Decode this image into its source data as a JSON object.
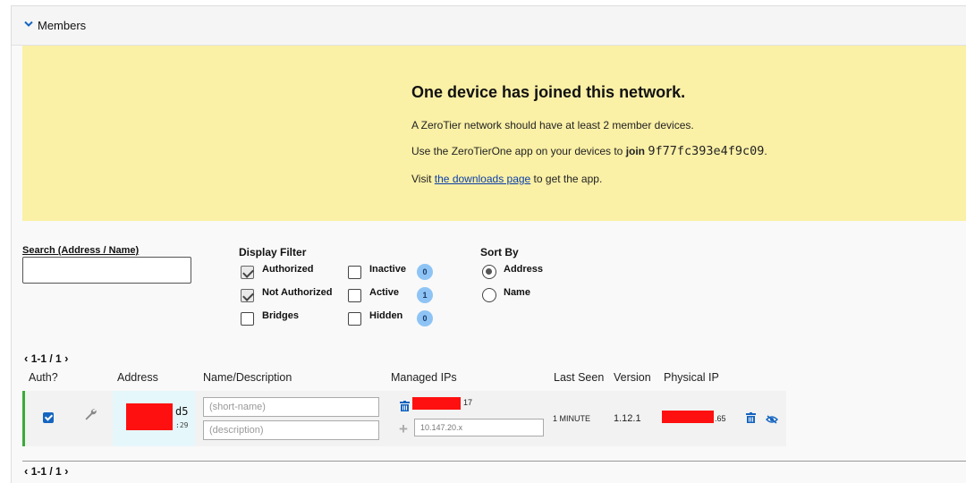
{
  "section": {
    "title": "Members"
  },
  "banner": {
    "heading": "One device has joined this network.",
    "line1": "A ZeroTier network should have at least 2 member devices.",
    "line2_prefix": "Use the ZeroTierOne app on your devices to ",
    "line2_join": "join",
    "network_id": "9f77fc393e4f9c09",
    "line2_suffix": ".",
    "line3_prefix": "Visit ",
    "line3_link": "the downloads page",
    "line3_suffix": " to get the app.",
    "background_color": "#faf0a6"
  },
  "search": {
    "label": "Search (Address / Name)",
    "value": ""
  },
  "display_filter": {
    "title": "Display Filter",
    "options": [
      {
        "label": "Authorized",
        "checked": true
      },
      {
        "label": "Not Authorized",
        "checked": true
      },
      {
        "label": "Bridges",
        "checked": false
      },
      {
        "label": "Inactive",
        "checked": false,
        "count": "0"
      },
      {
        "label": "Active",
        "checked": false,
        "count": "1"
      },
      {
        "label": "Hidden",
        "checked": false,
        "count": "0"
      }
    ]
  },
  "sort_by": {
    "title": "Sort By",
    "options": [
      {
        "label": "Address",
        "selected": true
      },
      {
        "label": "Name",
        "selected": false
      }
    ]
  },
  "pager": {
    "top": "1-1 / 1",
    "bottom": "1-1 / 1"
  },
  "table": {
    "headers": [
      "Auth?",
      "Address",
      "Name/Description",
      "Managed IPs",
      "Last Seen",
      "Version",
      "Physical IP"
    ],
    "rows": [
      {
        "authorized": true,
        "address_suffix": "d5",
        "address_sub": ":29",
        "name_placeholder": "(short-name)",
        "description_placeholder": "(description)",
        "managed_ip_suffix": "17",
        "new_ip_placeholder": "10.147.20.x",
        "last_seen": "1 MINUTE",
        "version": "1.12.1",
        "physical_ip_suffix": ".65"
      }
    ]
  },
  "colors": {
    "accent": "#1565c0",
    "active_border": "#3aab3a",
    "badge": "#8ec4f5",
    "redaction": "#ff1010"
  },
  "icons": [
    "chevron-down-icon",
    "chevron-left-icon",
    "chevron-right-icon",
    "wrench-icon",
    "trash-icon",
    "plus-icon",
    "eye-off-icon"
  ]
}
